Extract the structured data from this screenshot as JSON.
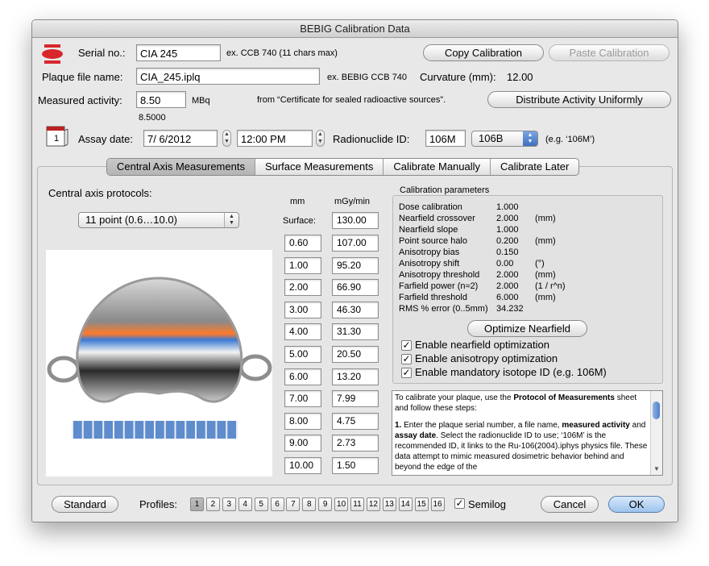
{
  "window": {
    "title": "BEBIG Calibration Data"
  },
  "header": {
    "serial_label": "Serial no.:",
    "serial_value": "CIA 245",
    "serial_hint": "ex. CCB 740   (11 chars max)",
    "plaque_label": "Plaque file name:",
    "plaque_value": "CIA_245.iplq",
    "plaque_hint": "ex. BEBIG CCB 740",
    "curvature_label": "Curvature (mm):",
    "curvature_value": "12.00",
    "activity_label": "Measured activity:",
    "activity_value": "8.50",
    "activity_unit": "MBq",
    "activity_source": "from “Certificate for sealed radioactive sources”.",
    "activity_readout": "8.5000",
    "assay_label": "Assay date:",
    "assay_date": "7/  6/2012",
    "assay_time": "12:00 PM",
    "calendar_day": "1",
    "radionuclide_label": "Radionuclide ID:",
    "radionuclide_value": "106M",
    "radionuclide_select": "106B",
    "radionuclide_hint": "(e.g. ‘106M’)",
    "copy_button": "Copy Calibration",
    "paste_button": "Paste Calibration",
    "distribute_button": "Distribute Activity Uniformly"
  },
  "tabs": [
    {
      "label": "Central Axis Measurements",
      "active": true
    },
    {
      "label": "Surface Measurements",
      "active": false
    },
    {
      "label": "Calibrate Manually",
      "active": false
    },
    {
      "label": "Calibrate Later",
      "active": false
    }
  ],
  "central": {
    "protocols_label": "Central axis protocols:",
    "protocol_selected": "11 point (0.6…10.0)",
    "col_mm": "mm",
    "col_dose": "mGy/min",
    "surface_label": "Surface:",
    "surface_value": "130.00",
    "rows": [
      {
        "mm": "0.60",
        "dose": "107.00"
      },
      {
        "mm": "1.00",
        "dose": "95.20"
      },
      {
        "mm": "2.00",
        "dose": "66.90"
      },
      {
        "mm": "3.00",
        "dose": "46.30"
      },
      {
        "mm": "4.00",
        "dose": "31.30"
      },
      {
        "mm": "5.00",
        "dose": "20.50"
      },
      {
        "mm": "6.00",
        "dose": "13.20"
      },
      {
        "mm": "7.00",
        "dose": "7.99"
      },
      {
        "mm": "8.00",
        "dose": "4.75"
      },
      {
        "mm": "9.00",
        "dose": "2.73"
      },
      {
        "mm": "10.00",
        "dose": "1.50"
      }
    ]
  },
  "calibration": {
    "title": "Calibration parameters",
    "params": [
      {
        "name": "Dose calibration",
        "value": "1.000",
        "unit": ""
      },
      {
        "name": "Nearfield crossover",
        "value": "2.000",
        "unit": "(mm)"
      },
      {
        "name": "Nearfield slope",
        "value": "1.000",
        "unit": ""
      },
      {
        "name": "Point source halo",
        "value": "0.200",
        "unit": "(mm)"
      },
      {
        "name": "Anisotropy bias",
        "value": "0.150",
        "unit": ""
      },
      {
        "name": "Anisotropy shift",
        "value": "0.00",
        "unit": "(°)"
      },
      {
        "name": "Anisotropy threshold",
        "value": "2.000",
        "unit": "(mm)"
      },
      {
        "name": "Farfield power (n≈2)",
        "value": "2.000",
        "unit": "(1 / r^n)"
      },
      {
        "name": "Farfield threshold",
        "value": "6.000",
        "unit": "(mm)"
      },
      {
        "name": "RMS % error (0..5mm)",
        "value": "34.232",
        "unit": ""
      }
    ],
    "optimize_button": "Optimize Nearfield",
    "checkboxes": [
      {
        "label": "Enable nearfield optimization",
        "checked": true
      },
      {
        "label": "Enable anisotropy optimization",
        "checked": true
      },
      {
        "label": "Enable mandatory isotope ID (e.g. 106M)",
        "checked": true
      }
    ]
  },
  "instructions": {
    "p1_a": "To calibrate your plaque, use the ",
    "p1_b": "Protocol of Measurements",
    "p1_c": " sheet and follow these steps:",
    "p2_num": "1.",
    "p2_a": " Enter the plaque serial number, a file name, ",
    "p2_b": "measured activity",
    "p2_c": " and ",
    "p2_d": "assay date",
    "p2_e": ". Select the radionuclide ID to use; ‘106M’ is the recommended ID, it links to the Ru-106(2004).iphys physics file. These data attempt to mimic measured dosimetric behavior behind and beyond the edge of the"
  },
  "footer": {
    "standard_button": "Standard",
    "profiles_label": "Profiles:",
    "profiles": [
      "1",
      "2",
      "3",
      "4",
      "5",
      "6",
      "7",
      "8",
      "9",
      "10",
      "11",
      "12",
      "13",
      "14",
      "15",
      "16"
    ],
    "semilog_label": "Semilog",
    "cancel_button": "Cancel",
    "ok_button": "OK"
  },
  "colors": {
    "accent": "#4a7cc4",
    "default_button": "#9cc3ee",
    "logo_red": "#d8262b"
  }
}
